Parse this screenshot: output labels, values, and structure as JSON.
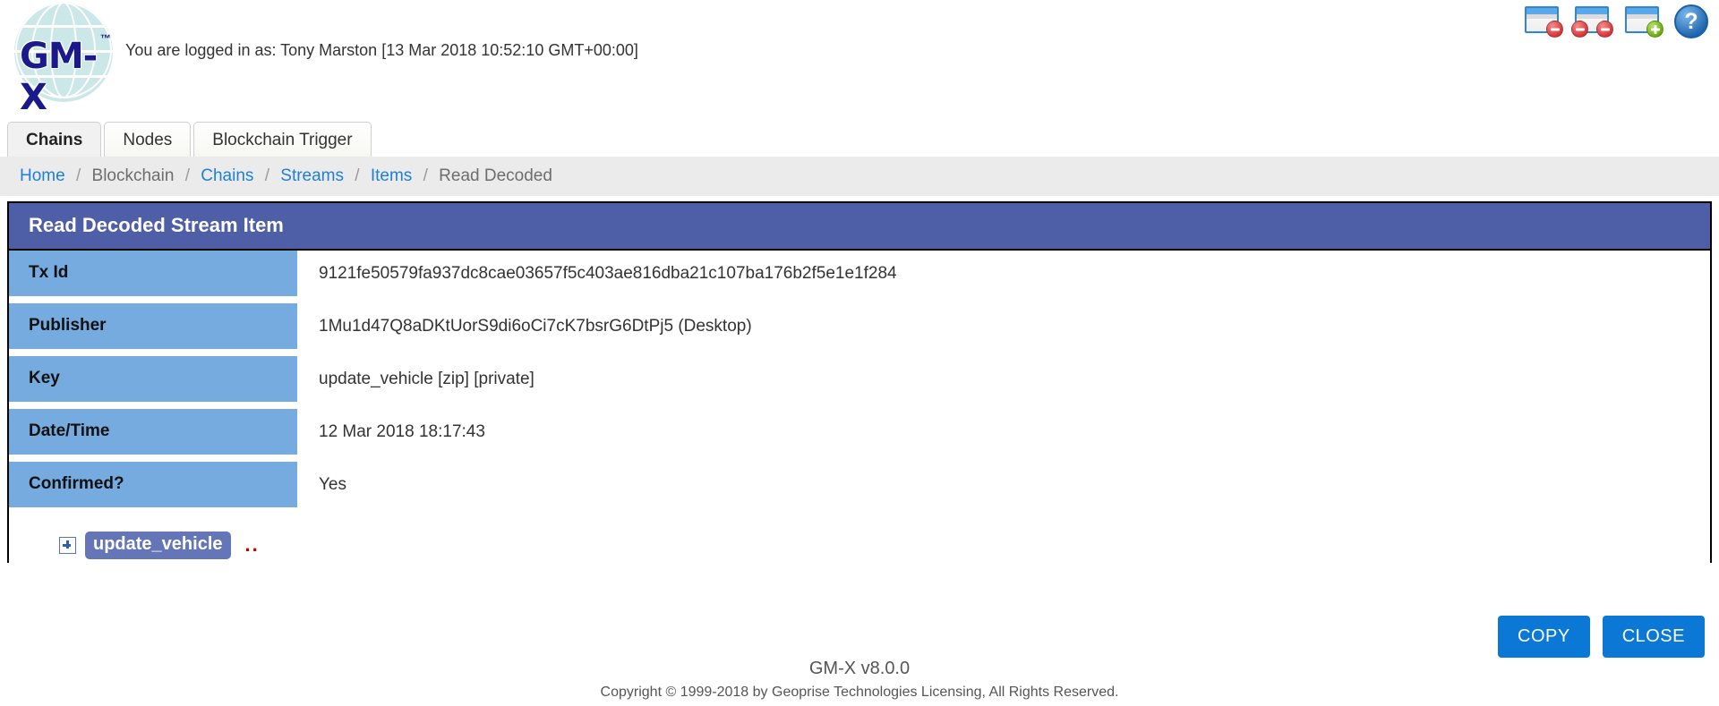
{
  "header": {
    "logo_text": "GM-X",
    "logo_tm": "™",
    "login_line": "You are logged in as: Tony Marston [13 Mar 2018 10:52:10 GMT+00:00]",
    "icons": [
      {
        "name": "close-window-icon",
        "title": "Close this window"
      },
      {
        "name": "close-all-windows-icon",
        "title": "Close all windows"
      },
      {
        "name": "new-window-icon",
        "title": "Open new window"
      },
      {
        "name": "help-icon",
        "glyph": "?",
        "title": "Help"
      }
    ]
  },
  "tabs": [
    {
      "label": "Chains",
      "active": true
    },
    {
      "label": "Nodes",
      "active": false
    },
    {
      "label": "Blockchain Trigger",
      "active": false
    }
  ],
  "breadcrumb": [
    {
      "label": "Home",
      "link": true
    },
    {
      "label": "Blockchain",
      "link": false
    },
    {
      "label": "Chains",
      "link": true
    },
    {
      "label": "Streams",
      "link": true
    },
    {
      "label": "Items",
      "link": true
    },
    {
      "label": "Read Decoded",
      "link": false
    }
  ],
  "breadcrumb_separator": "/",
  "panel": {
    "title": "Read Decoded Stream Item",
    "rows": [
      {
        "label": "Tx Id",
        "value": "9121fe50579fa937dc8cae03657f5c403ae816dba21c107ba176b2f5e1e1f284"
      },
      {
        "label": "Publisher",
        "value": "1Mu1d47Q8aDKtUorS9di6oCi7cK7bsrG6DtPj5 (Desktop)"
      },
      {
        "label": "Key",
        "value": "update_vehicle [zip] [private]"
      },
      {
        "label": "Date/Time",
        "value": "12 Mar 2018 18:17:43"
      },
      {
        "label": "Confirmed?",
        "value": "Yes"
      }
    ],
    "tree": {
      "expander": "+",
      "node_label": "update_vehicle",
      "trailing_dots": ".."
    }
  },
  "actions": [
    {
      "label": "COPY",
      "name": "copy-button"
    },
    {
      "label": "CLOSE",
      "name": "close-button"
    }
  ],
  "footer": {
    "version": "GM-X v8.0.0",
    "copyright": "Copyright © 1999-2018 by Geoprise Technologies Licensing, All Rights Reserved."
  },
  "colors": {
    "panel_title_bg": "#4e5fa8",
    "row_label_bg": "#76abe0",
    "button_bg": "#0a78d4",
    "link": "#1f7fd8",
    "breadcrumb_bg": "#ebebeb",
    "node_chip_bg": "#6576b8",
    "dots": "#c00000",
    "logo_globe": "#cbe7e8",
    "logo_type": "#1a1a8c"
  }
}
